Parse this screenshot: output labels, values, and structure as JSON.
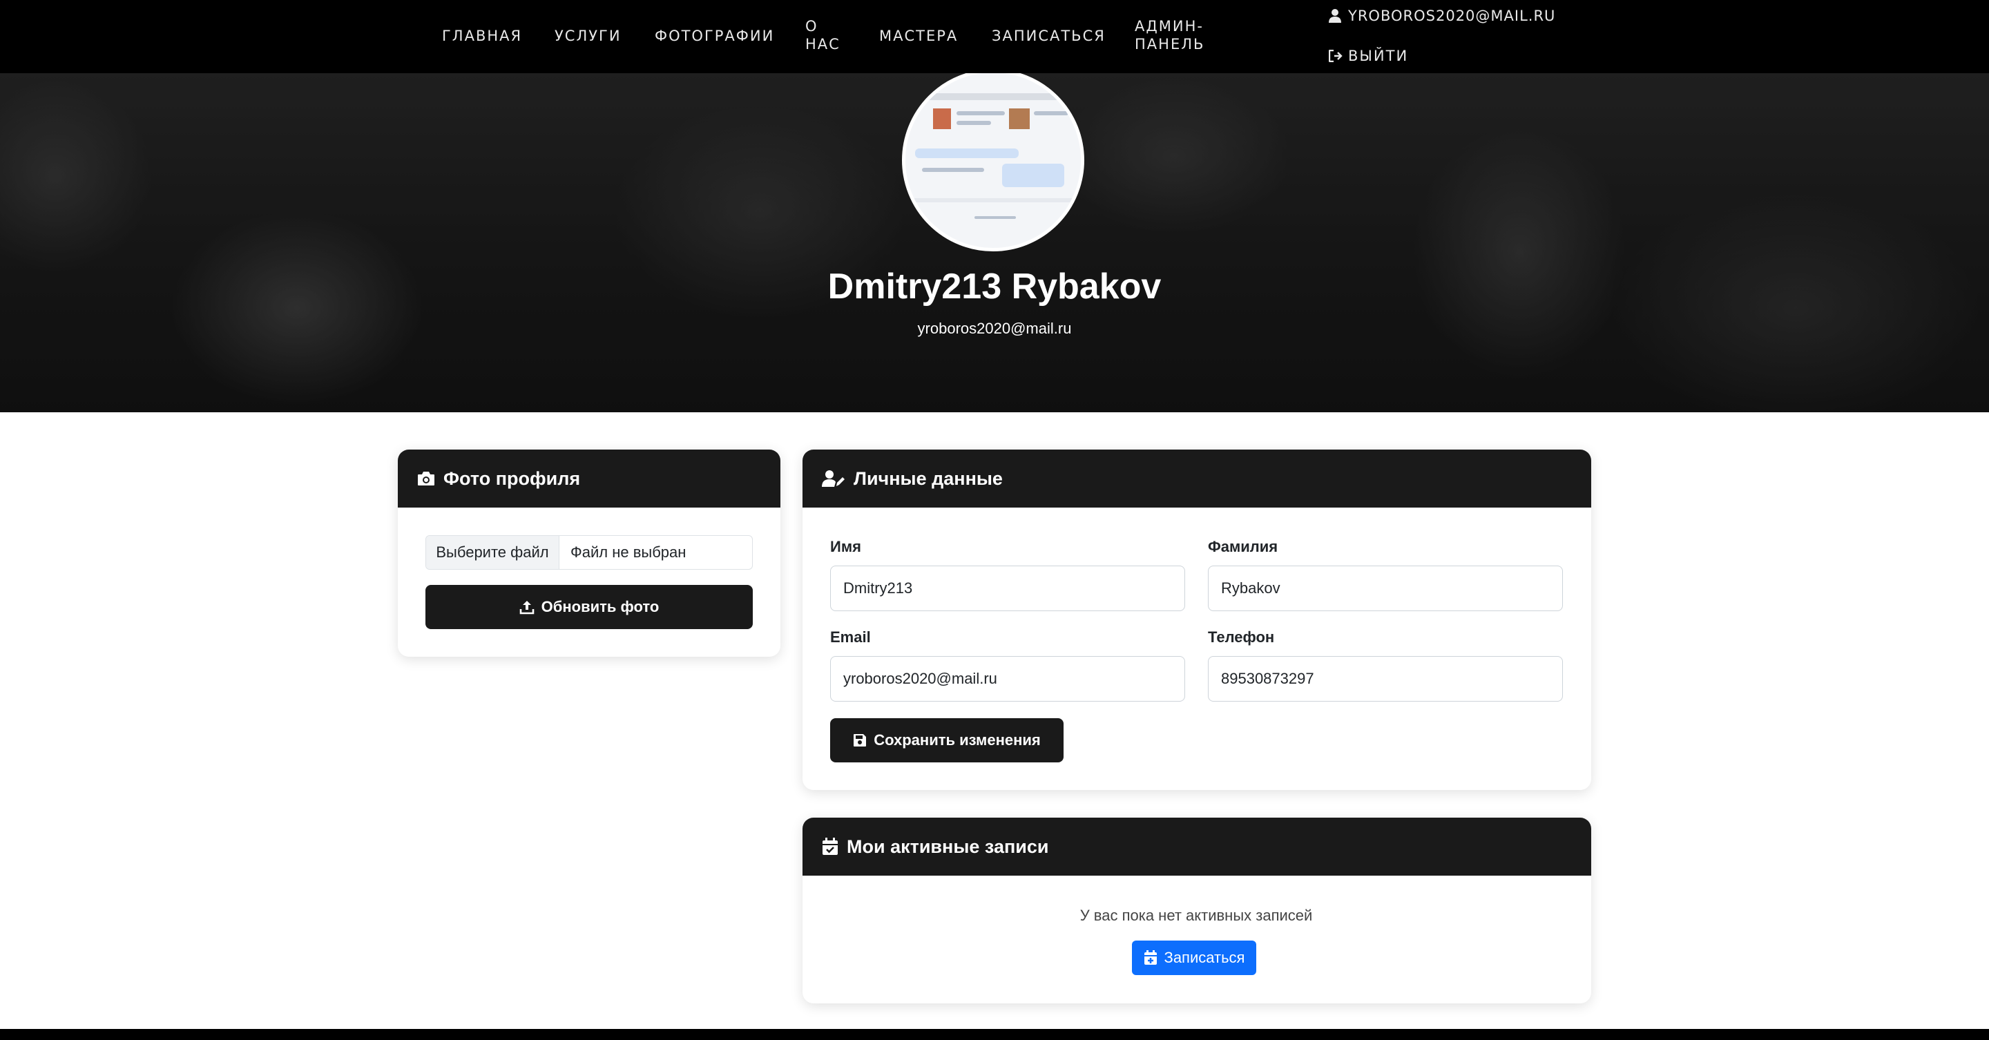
{
  "nav": {
    "items": [
      {
        "label": "ГЛАВНАЯ"
      },
      {
        "label": "УСЛУГИ"
      },
      {
        "label": "ФОТОГРАФИИ"
      },
      {
        "label_line1": "О",
        "label_line2": "НАС"
      },
      {
        "label": "МАСТЕРА"
      },
      {
        "label": "ЗАПИСАТЬСЯ"
      },
      {
        "label_line1": "АДМИН-",
        "label_line2": "ПАНЕЛЬ"
      }
    ],
    "user_email": "YROBOROS2020@MAIL.RU",
    "logout_label": "ВЫЙТИ"
  },
  "hero": {
    "name": "Dmitry213 Rybakov",
    "email": "yroboros2020@mail.ru"
  },
  "photo_card": {
    "title": "Фото профиля",
    "file_button": "Выберите файл",
    "file_status": "Файл не выбран",
    "update_button": "Обновить фото"
  },
  "personal_card": {
    "title": "Личные данные",
    "first_name_label": "Имя",
    "first_name_value": "Dmitry213",
    "last_name_label": "Фамилия",
    "last_name_value": "Rybakov",
    "email_label": "Email",
    "email_value": "yroboros2020@mail.ru",
    "phone_label": "Телефон",
    "phone_value": "89530873297",
    "save_button": "Сохранить изменения"
  },
  "appointments_card": {
    "title": "Мои активные записи",
    "empty_message": "У вас пока нет активных записей",
    "book_button": "Записаться"
  },
  "colors": {
    "navbar_bg": "#000000",
    "card_header_bg": "#1a1a1a",
    "primary_blue": "#0d6efd"
  }
}
